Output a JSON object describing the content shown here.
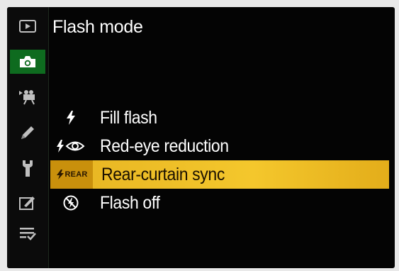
{
  "header": {
    "title": "Flash mode"
  },
  "sidebar": {
    "items": [
      {
        "icon": "playback-icon"
      },
      {
        "icon": "camera-icon",
        "active": true
      },
      {
        "icon": "movie-icon"
      },
      {
        "icon": "pencil-icon"
      },
      {
        "icon": "wrench-icon"
      },
      {
        "icon": "retouch-icon"
      },
      {
        "icon": "my-menu-icon"
      }
    ]
  },
  "menu": {
    "items": [
      {
        "label": "Fill flash",
        "icon": "flash-icon"
      },
      {
        "label": "Red-eye reduction",
        "icon": "flash-red-eye-icon"
      },
      {
        "label": "Rear-curtain sync",
        "icon": "flash-rear-icon",
        "badge": "REAR",
        "selected": true
      },
      {
        "label": "Flash off",
        "icon": "flash-off-icon"
      }
    ]
  },
  "colors": {
    "highlight": "#f4c72c",
    "active_tab": "#0e6b1f",
    "background": "#040404"
  }
}
